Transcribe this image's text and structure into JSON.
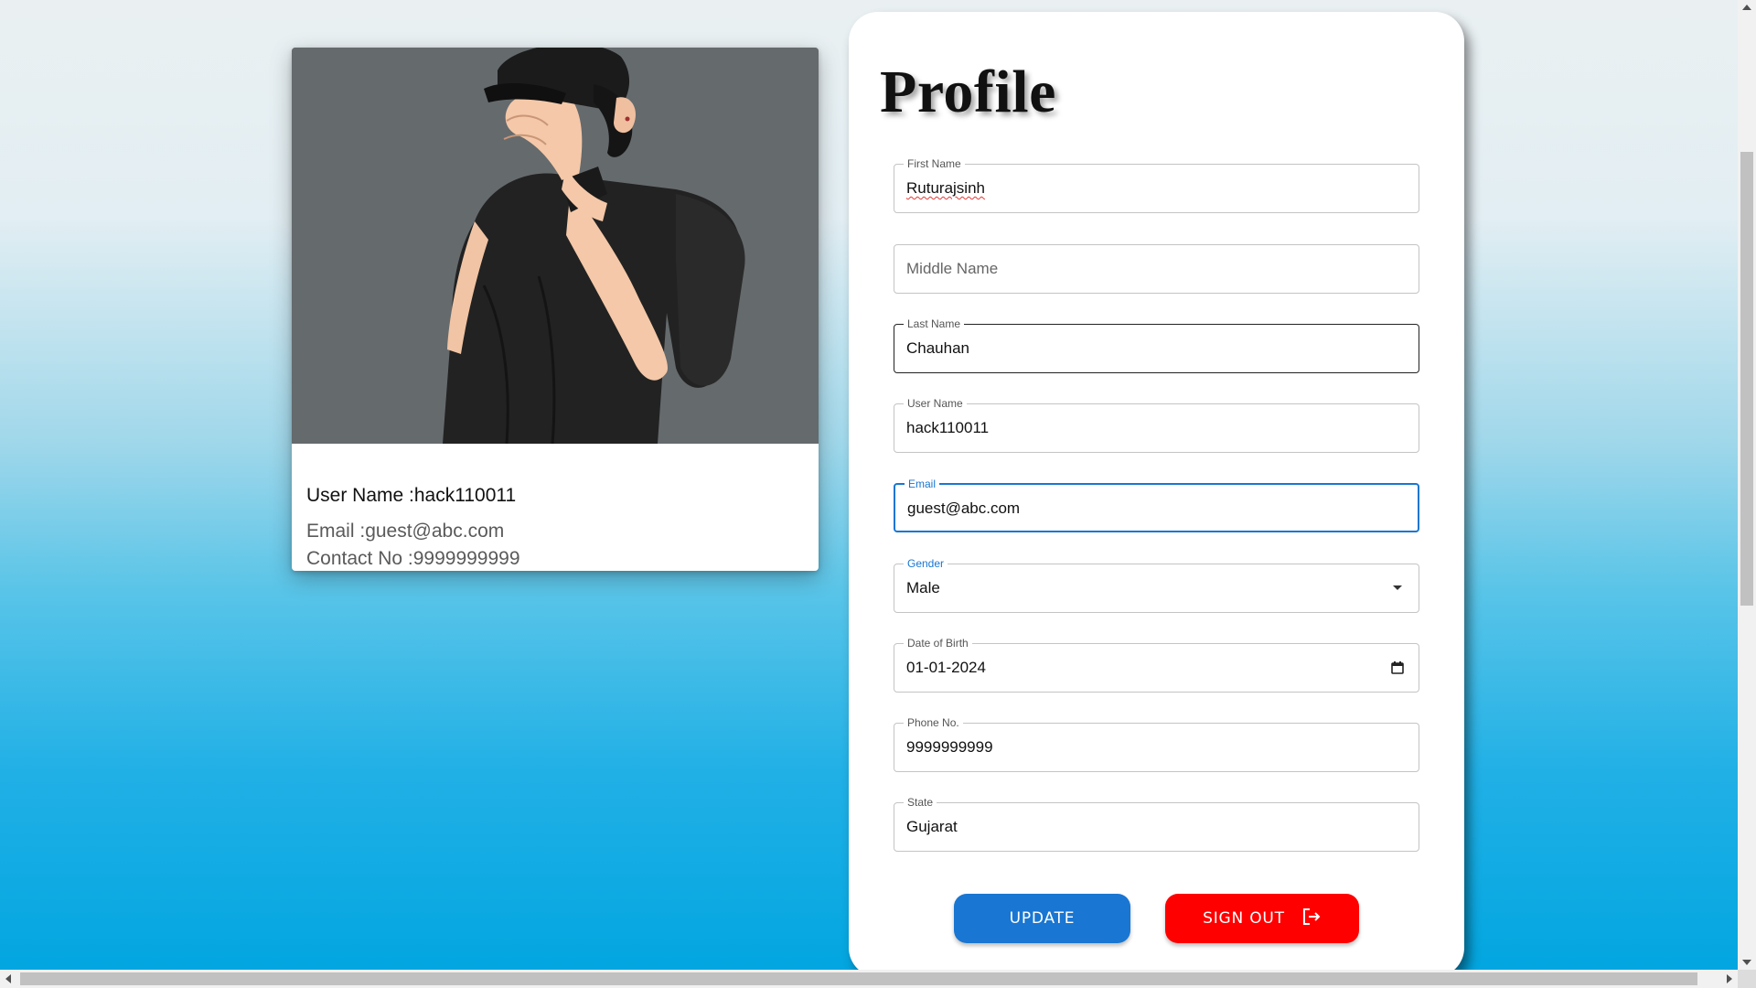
{
  "user_card": {
    "username_label": "User Name :",
    "username_value": "hack110011",
    "email_label": "Email :",
    "email_value": "guest@abc.com",
    "contact_label": "Contact No :",
    "contact_value": "9999999999",
    "avatar_icon": "avatar-illustration"
  },
  "profile": {
    "title": "Profile",
    "fields": {
      "first_name": {
        "label": "First Name",
        "value": "Ruturajsinh"
      },
      "middle_name": {
        "placeholder": "Middle Name",
        "value": ""
      },
      "last_name": {
        "label": "Last Name",
        "value": "Chauhan"
      },
      "user_name": {
        "label": "User Name",
        "value": "hack110011"
      },
      "email": {
        "label": "Email",
        "value": "guest@abc.com"
      },
      "gender": {
        "label": "Gender",
        "value": "Male",
        "icon": "dropdown-arrow-icon"
      },
      "dob": {
        "label": "Date of Birth",
        "value": "01-01-2024",
        "icon": "calendar-icon"
      },
      "phone": {
        "label": "Phone No.",
        "value": "9999999999"
      },
      "state": {
        "label": "State",
        "value": "Gujarat"
      }
    },
    "buttons": {
      "update": "UPDATE",
      "sign_out": "SIGN OUT",
      "sign_out_icon": "logout-icon"
    }
  },
  "colors": {
    "primary": "#1976d2",
    "danger": "#ff0000",
    "focus_outline": "#1976d2"
  }
}
